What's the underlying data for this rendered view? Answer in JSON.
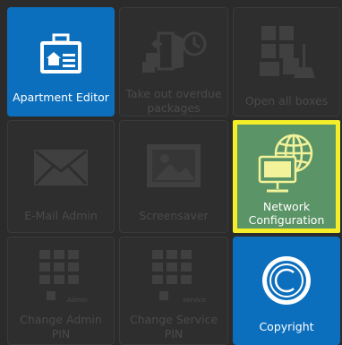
{
  "tiles": {
    "apartment_editor": {
      "label": "Apartment Editor",
      "icon": "id-card-home-icon",
      "state": "active"
    },
    "take_out_overdue": {
      "label": "Take out overdue\npackages",
      "icon": "packages-door-icon",
      "state": "disabled"
    },
    "open_all_boxes": {
      "label": "Open all boxes",
      "icon": "boxes-broom-icon",
      "state": "disabled"
    },
    "email_admin": {
      "label": "E-Mail Admin",
      "icon": "envelope-icon",
      "state": "disabled"
    },
    "screensaver": {
      "label": "Screensaver",
      "icon": "image-icon",
      "state": "disabled"
    },
    "network_configuration": {
      "label": "Network\nConfiguration",
      "icon": "globe-computer-icon",
      "state": "selected"
    },
    "change_admin_pin": {
      "label": "Change Admin\nPIN",
      "icon": "keypad-icon",
      "badge": "Admin",
      "state": "disabled"
    },
    "change_service_pin": {
      "label": "Change Service\nPIN",
      "icon": "keypad-icon",
      "badge": "Service",
      "state": "disabled"
    },
    "copyright": {
      "label": "Copyright",
      "icon": "copyright-icon",
      "state": "active"
    }
  },
  "colors": {
    "background": "#2b2b2b",
    "active_blue": "#0c6fbd",
    "selected_green": "#5b9466",
    "selection_border": "#f4ee2a",
    "disabled_text": "#4a4a4a"
  }
}
